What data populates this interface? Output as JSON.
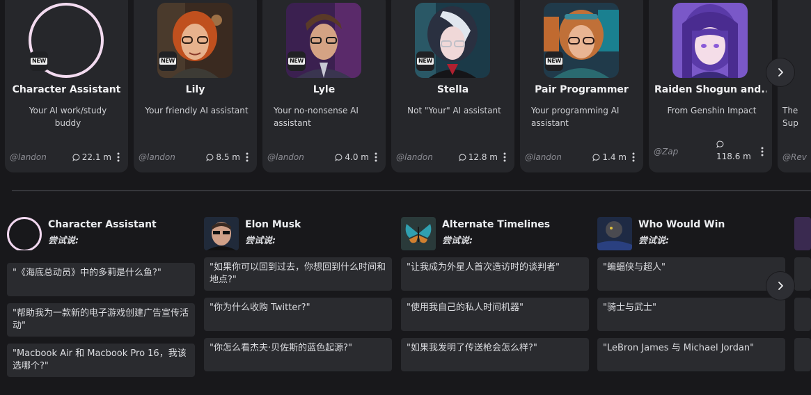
{
  "characters": [
    {
      "name": "Character Assistant",
      "desc": "Your AI work/study buddy",
      "creator": "@landon",
      "chats": "22.1 m",
      "badge": "NEW"
    },
    {
      "name": "Lily",
      "desc": "Your friendly AI assistant",
      "creator": "@landon",
      "chats": "8.5 m",
      "badge": "NEW"
    },
    {
      "name": "Lyle",
      "desc": "Your no-nonsense AI assistant",
      "creator": "@landon",
      "chats": "4.0 m",
      "badge": "NEW"
    },
    {
      "name": "Stella",
      "desc": "Not \"Your\" AI assistant",
      "creator": "@landon",
      "chats": "12.8 m",
      "badge": "NEW"
    },
    {
      "name": "Pair Programmer",
      "desc": "Your programming AI assistant",
      "creator": "@landon",
      "chats": "1.4 m",
      "badge": "NEW"
    },
    {
      "name": "Raiden Shogun and...",
      "desc": "From Genshin Impact",
      "creator": "@Zap",
      "chats": "118.6 m"
    },
    {
      "name": "",
      "desc": "The Sup",
      "creator": "@Rev",
      "chats": ""
    }
  ],
  "suggestions": [
    {
      "title": "Character Assistant",
      "try_label": "尝试说:",
      "prompts": [
        "\"《海底总动员》中的多莉是什么鱼?\"",
        "\"帮助我为一款新的电子游戏创建广告宣传活动\"",
        "\"Macbook Air 和 Macbook Pro 16，我该选哪个?\""
      ]
    },
    {
      "title": "Elon Musk",
      "try_label": "尝试说:",
      "prompts": [
        "\"如果你可以回到过去，你想回到什么时间和地点?\"",
        "\"你为什么收购 Twitter?\"",
        "\"你怎么看杰夫·贝佐斯的蓝色起源?\""
      ]
    },
    {
      "title": "Alternate Timelines",
      "try_label": "尝试说:",
      "prompts": [
        "\"让我成为外星人首次造访时的谈判者\"",
        "\"使用我自己的私人时间机器\"",
        "\"如果我发明了传送枪会怎么样?\""
      ]
    },
    {
      "title": "Who Would Win",
      "try_label": "尝试说:",
      "prompts": [
        "\"蝙蝠侠与超人\"",
        "\"骑士与武士\"",
        "\"LeBron James 与 Michael Jordan\""
      ]
    }
  ],
  "colors": {
    "page_bg": "#18181b",
    "card_bg": "#26272b",
    "prompt_bg": "#2a2b2f",
    "ring": "#f3dbf0"
  },
  "icons": {
    "chat": "chat-bubble-icon",
    "more": "kebab-menu-icon",
    "next": "chevron-right-icon"
  }
}
